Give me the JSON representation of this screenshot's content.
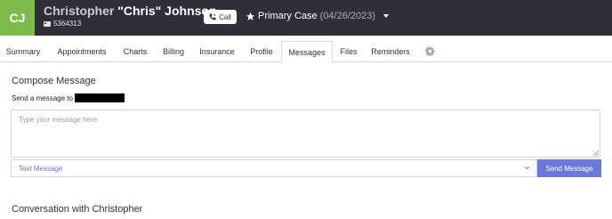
{
  "header": {
    "avatar_initials": "CJ",
    "patient_first": "Christopher",
    "patient_rest": " \"Chris\" Johnson",
    "patient_id": "5364313",
    "call_label": "Call",
    "case_label": "Primary Case",
    "case_date": "(04/26/2023)"
  },
  "tabs": [
    {
      "label": "Summary"
    },
    {
      "label": "Appointments"
    },
    {
      "label": "Charts"
    },
    {
      "label": "Billing"
    },
    {
      "label": "Insurance"
    },
    {
      "label": "Profile"
    },
    {
      "label": "Messages",
      "active": true
    },
    {
      "label": "Files"
    },
    {
      "label": "Reminders"
    }
  ],
  "compose": {
    "title": "Compose Message",
    "send_to_label": "Send a message to",
    "message_placeholder": "Type your message here",
    "message_value": "",
    "channel_selected": "Text Message",
    "send_label": "Send Message"
  },
  "conversation": {
    "title": "Conversation with Christopher"
  },
  "colors": {
    "header_bg": "#2f3037",
    "avatar_bg": "#7cba4b",
    "accent": "#6979d8"
  },
  "icons": {
    "id": "id-card-icon",
    "call": "phone-icon",
    "case": "star-icon",
    "settings": "gear-icon",
    "dropdown": "chevron-down-icon"
  }
}
